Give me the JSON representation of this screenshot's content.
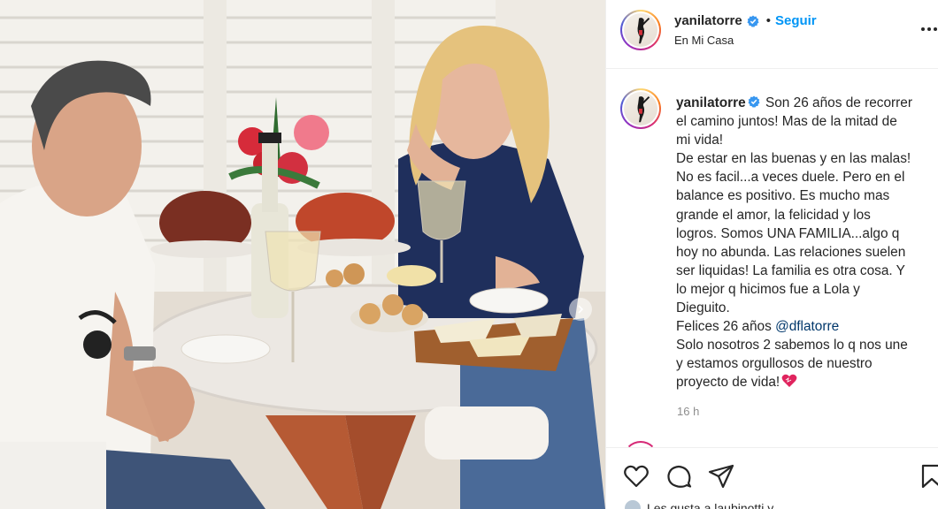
{
  "post": {
    "username": "yanilatorre",
    "follow_label": "Seguir",
    "separator": "•",
    "location": "En Mi Casa",
    "caption": {
      "username": "yanilatorre",
      "lines": [
        "Son 26 años de recorrer",
        "el camino juntos! Mas de la mitad de",
        "mi vida!",
        "De estar en las buenas y en las malas!",
        "No es facil...a veces duele. Pero en el",
        "balance es positivo. Es mucho mas",
        "grande el amor, la felicidad y los",
        "logros. Somos UNA FAMILIA...algo q",
        "hoy no abunda. Las relaciones suelen",
        "ser liquidas! La familia es otra cosa. Y",
        "lo mejor q hicimos fue a Lola y",
        "Dieguito."
      ],
      "anniversary_prefix": "Felices 26 años ",
      "mention": "@dflatorre",
      "closing_lines": [
        "Solo nosotros 2 sabemos lo q nos une",
        "y estamos orgullosos de nuestro",
        "proyecto de vida!"
      ]
    },
    "time_ago": "16 h",
    "likes_text": "Les gusta a laubinotti y"
  },
  "icons": {
    "verified": "verified-badge-icon",
    "more": "more-options-icon",
    "like": "heart-icon",
    "comment": "comment-icon",
    "share": "paper-plane-icon",
    "save": "bookmark-icon",
    "carousel": "chevron-right-icon"
  },
  "colors": {
    "accent": "#0095f6",
    "verified": "#3897f0",
    "mention": "#00376b",
    "muted": "#8e8e8e",
    "text": "#262626",
    "heart_emoji": "#e0245e"
  }
}
